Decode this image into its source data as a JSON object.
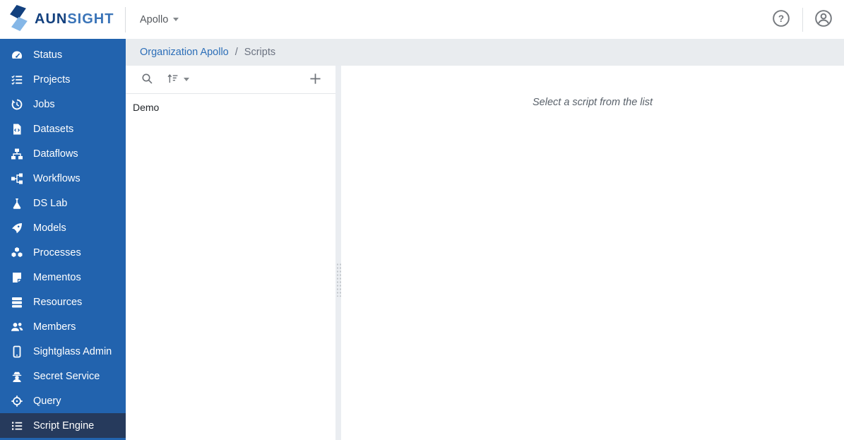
{
  "header": {
    "logo": {
      "primary": "AUN",
      "secondary": "SIGHT",
      "icon": "aunsight-logo-icon"
    },
    "org_selector_label": "Apollo",
    "help_icon": "help-icon",
    "account_icon": "account-icon"
  },
  "sidebar": {
    "items": [
      {
        "label": "Status",
        "icon": "gauge-icon",
        "active": false
      },
      {
        "label": "Projects",
        "icon": "task-list-icon",
        "active": false
      },
      {
        "label": "Jobs",
        "icon": "history-icon",
        "active": false
      },
      {
        "label": "Datasets",
        "icon": "file-code-icon",
        "active": false
      },
      {
        "label": "Dataflows",
        "icon": "sitemap-icon",
        "active": false
      },
      {
        "label": "Workflows",
        "icon": "flow-icon",
        "active": false
      },
      {
        "label": "DS Lab",
        "icon": "flask-icon",
        "active": false
      },
      {
        "label": "Models",
        "icon": "shuttle-icon",
        "active": false
      },
      {
        "label": "Processes",
        "icon": "cubes-icon",
        "active": false
      },
      {
        "label": "Mementos",
        "icon": "sticky-note-icon",
        "active": false
      },
      {
        "label": "Resources",
        "icon": "server-icon",
        "active": false
      },
      {
        "label": "Members",
        "icon": "users-icon",
        "active": false
      },
      {
        "label": "Sightglass Admin",
        "icon": "tablet-icon",
        "active": false
      },
      {
        "label": "Secret Service",
        "icon": "user-secret-icon",
        "active": false
      },
      {
        "label": "Query",
        "icon": "crosshairs-icon",
        "active": false
      },
      {
        "label": "Script Engine",
        "icon": "list-icon",
        "active": true
      }
    ]
  },
  "breadcrumb": {
    "org_link": "Organization Apollo",
    "separator": "/",
    "current": "Scripts"
  },
  "list_panel": {
    "toolbar_icons": [
      "search-icon",
      "sort-ascending-icon",
      "caret-down-icon",
      "plus-icon"
    ],
    "scripts": [
      {
        "label": "Demo"
      }
    ]
  },
  "main": {
    "empty_message": "Select a script from the list"
  },
  "colors": {
    "sidebar_blue": "#2263ae",
    "sidebar_active_navy": "#263a5c",
    "logo_dark_blue": "#12407e",
    "logo_light_blue": "#85b7e7",
    "breadcrumb_bg": "#e9ecef",
    "link_blue": "#2c6eb8",
    "icon_gray": "#6d7278"
  }
}
